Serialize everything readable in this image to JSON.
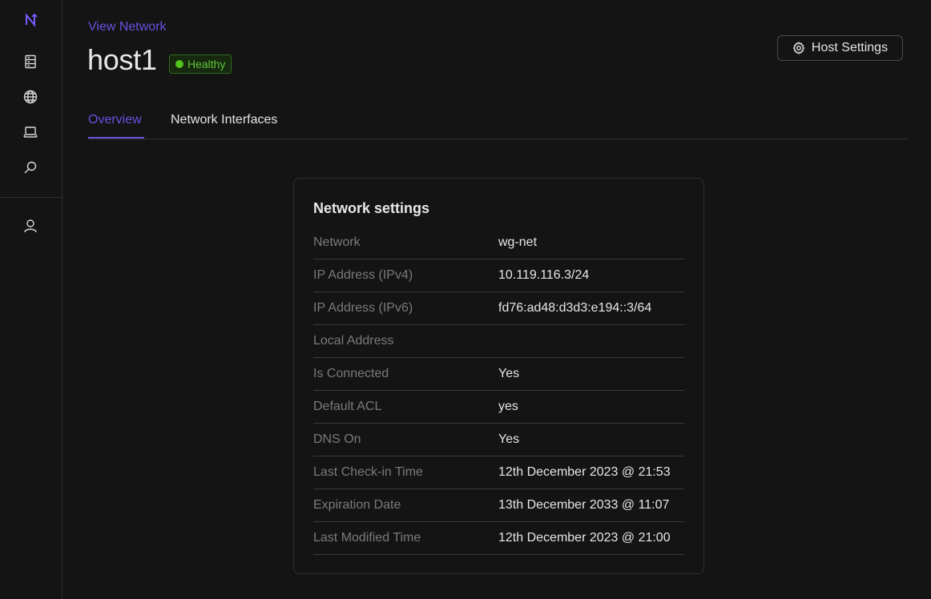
{
  "sidebar": {
    "icons": [
      "logo-icon",
      "servers-icon",
      "globe-icon",
      "laptop-icon",
      "search-icon",
      "user-icon"
    ]
  },
  "header": {
    "breadcrumb": "View Network",
    "title": "host1",
    "status": "Healthy",
    "host_settings_label": "Host Settings"
  },
  "tabs": [
    {
      "label": "Overview",
      "active": true
    },
    {
      "label": "Network Interfaces",
      "active": false
    }
  ],
  "card": {
    "title": "Network settings",
    "rows": [
      {
        "label": "Network",
        "value": "wg-net"
      },
      {
        "label": "IP Address (IPv4)",
        "value": "10.119.116.3/24"
      },
      {
        "label": "IP Address (IPv6)",
        "value": "fd76:ad48:d3d3:e194::3/64"
      },
      {
        "label": "Local Address",
        "value": ""
      },
      {
        "label": "Is Connected",
        "value": "Yes"
      },
      {
        "label": "Default ACL",
        "value": "yes"
      },
      {
        "label": "DNS On",
        "value": "Yes"
      },
      {
        "label": "Last Check-in Time",
        "value": "12th December 2023 @ 21:53"
      },
      {
        "label": "Expiration Date",
        "value": "13th December 2033 @ 11:07"
      },
      {
        "label": "Last Modified Time",
        "value": "12th December 2023 @ 21:00"
      }
    ]
  },
  "colors": {
    "accent": "#6b4fe0",
    "healthy": "#52c41a",
    "background": "#141414"
  }
}
